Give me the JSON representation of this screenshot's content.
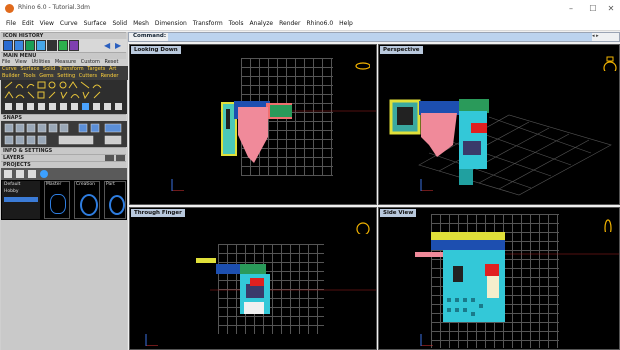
{
  "window": {
    "title": "Rhino 6.0 - Tutorial.3dm",
    "controls": [
      "–",
      "☐",
      "✕"
    ]
  },
  "menubar": {
    "items": [
      "File",
      "Edit",
      "View",
      "Curve",
      "Surface",
      "Solid",
      "Mesh",
      "Dimension",
      "Transform",
      "Tools",
      "Analyze",
      "Render",
      "Rhino6.0",
      "Help"
    ]
  },
  "left_panel": {
    "icon_history": "ICON HISTORY",
    "main_menu": "MAIN MENU",
    "menu_tabs": [
      "File",
      "View",
      "Utilities",
      "Measure",
      "Custom",
      "Reset"
    ],
    "menu_categories": [
      "Curve",
      "Surface",
      "Solid",
      "Transform",
      "Targets",
      "Art",
      "Builder",
      "Tools",
      "Gems",
      "Setting",
      "Cutters",
      "Render"
    ],
    "snaps": "SNAPS",
    "info_settings": "INFO & SETTINGS",
    "layers": "LAYERS",
    "projects": "PROJECTS",
    "project_list": [
      "Default",
      "Hobby"
    ],
    "project_thumbs": [
      "Master",
      "Creation",
      "Part"
    ]
  },
  "command": {
    "label": "Command:",
    "value": ""
  },
  "viewports": [
    {
      "title": "Looking Down"
    },
    {
      "title": "Perspective"
    },
    {
      "title": "Through Finger"
    },
    {
      "title": "Side View"
    }
  ],
  "colors": {
    "accent": "#b9c9dd",
    "grid": "#555555",
    "menu_category_text": "#ffd23c",
    "gimbal": "#f2b300"
  }
}
